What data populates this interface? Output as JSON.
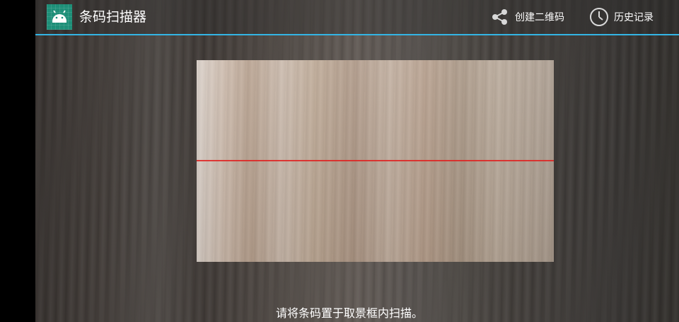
{
  "app": {
    "title": "条码扫描器",
    "icon": "android-robot-icon"
  },
  "toolbar": {
    "share_label": "创建二维码",
    "share_icon": "share-icon",
    "history_label": "历史记录",
    "history_icon": "clock-icon",
    "overflow_icon": "more-vertical-icon",
    "divider_color": "#33b5e5"
  },
  "scanner": {
    "laser_color": "#e0201e",
    "status_text": "请将条码置于取景框内扫描。"
  }
}
